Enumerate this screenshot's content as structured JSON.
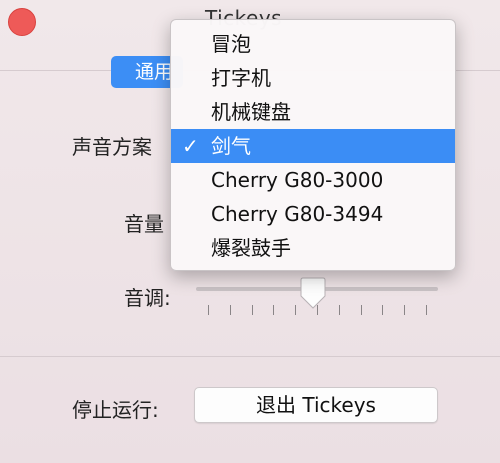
{
  "window": {
    "title": "Tickeys",
    "close_color": "#ee5a58",
    "accent_color": "#3c8ef5"
  },
  "tab": {
    "label": "通用"
  },
  "labels": {
    "sound_scheme": "声音方案",
    "volume": "音量",
    "pitch": "音调:",
    "stop": "停止运行:"
  },
  "pitch_slider": {
    "value_fraction": 0.48,
    "tick_count": 11
  },
  "quit_button": {
    "label": "退出 Tickeys"
  },
  "menu": {
    "check_mark": "✓",
    "selected_index": 3,
    "items": [
      {
        "label": "冒泡"
      },
      {
        "label": "打字机"
      },
      {
        "label": "机械键盘"
      },
      {
        "label": "剑气"
      },
      {
        "label": "Cherry G80-3000"
      },
      {
        "label": "Cherry G80-3494"
      },
      {
        "label": "爆裂鼓手"
      }
    ]
  }
}
